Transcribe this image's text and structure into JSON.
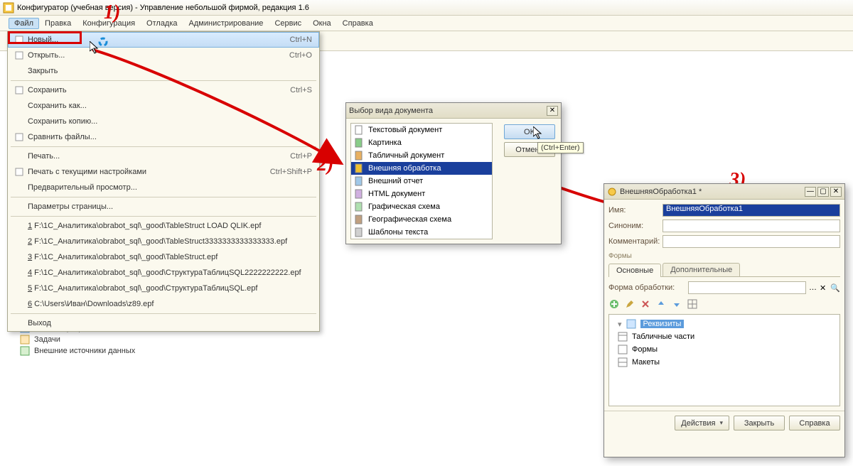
{
  "app": {
    "title": "Конфигуратор (учебная версия) - Управление небольшой фирмой, редакция 1.6"
  },
  "menubar": [
    "Файл",
    "Правка",
    "Конфигурация",
    "Отладка",
    "Администрирование",
    "Сервис",
    "Окна",
    "Справка"
  ],
  "file_menu": {
    "items": [
      {
        "label": "Новый...",
        "shortcut": "Ctrl+N",
        "underline": true,
        "hl": true,
        "icon": "new"
      },
      {
        "label": "Открыть...",
        "shortcut": "Ctrl+O",
        "icon": "open"
      },
      {
        "label": "Закрыть",
        "disabled": true
      },
      {
        "sep": true
      },
      {
        "label": "Сохранить",
        "shortcut": "Ctrl+S",
        "disabled": true,
        "icon": "save"
      },
      {
        "label": "Сохранить как...",
        "disabled": true
      },
      {
        "label": "Сохранить копию...",
        "disabled": true
      },
      {
        "label": "Сравнить файлы...",
        "icon": "compare"
      },
      {
        "sep": true
      },
      {
        "label": "Печать...",
        "shortcut": "Ctrl+P",
        "disabled": true
      },
      {
        "label": "Печать с текущими настройками",
        "shortcut": "Ctrl+Shift+P",
        "disabled": true,
        "icon": "print"
      },
      {
        "label": "Предварительный просмотр...",
        "disabled": true
      },
      {
        "sep": true
      },
      {
        "label": "Параметры страницы...",
        "disabled": true
      },
      {
        "sep": true
      },
      {
        "label": "1 F:\\1С_Аналитика\\obrabot_sql\\_good\\TableStruct LOAD QLIK.epf",
        "underline_first": "1"
      },
      {
        "label": "2 F:\\1С_Аналитика\\obrabot_sql\\_good\\TableStruct3333333333333333.epf",
        "underline_first": "2"
      },
      {
        "label": "3 F:\\1С_Аналитика\\obrabot_sql\\_good\\TableStruct.epf",
        "underline_first": "3"
      },
      {
        "label": "4 F:\\1С_Аналитика\\obrabot_sql\\_good\\СтруктураТаблицSQL2222222222.epf",
        "underline_first": "4"
      },
      {
        "label": "5 F:\\1С_Аналитика\\obrabot_sql\\_good\\СтруктураТаблицSQL.epf",
        "underline_first": "5"
      },
      {
        "label": "6 C:\\Users\\Иван\\Downloads\\z89.epf",
        "underline_first": "6"
      },
      {
        "sep": true
      },
      {
        "label": "Выход"
      }
    ]
  },
  "left_tree": [
    "Бизнес-процессы",
    "Задачи",
    "Внешние источники данных"
  ],
  "docsel": {
    "title": "Выбор вида документа",
    "items": [
      "Текстовый документ",
      "Картинка",
      "Табличный документ",
      "Внешняя обработка",
      "Внешний отчет",
      "HTML документ",
      "Графическая схема",
      "Географическая схема",
      "Шаблоны текста"
    ],
    "selected": 3,
    "ok": "OK",
    "cancel": "Отмена",
    "tooltip": "(Ctrl+Enter)"
  },
  "extproc": {
    "title": "ВнешняяОбработка1 *",
    "labels": {
      "name": "Имя:",
      "syn": "Синоним:",
      "comment": "Комментарий:",
      "forms_group": "Формы",
      "main": "Основные",
      "extra": "Дополнительные",
      "form_proc": "Форма обработки:"
    },
    "name_value": "ВнешняяОбработка1",
    "tree": [
      "Реквизиты",
      "Табличные части",
      "Формы",
      "Макеты"
    ],
    "footer": {
      "actions": "Действия",
      "close": "Закрыть",
      "help": "Справка"
    }
  },
  "markers": {
    "n1": "1)",
    "n2": "2)",
    "n3": "3)"
  }
}
